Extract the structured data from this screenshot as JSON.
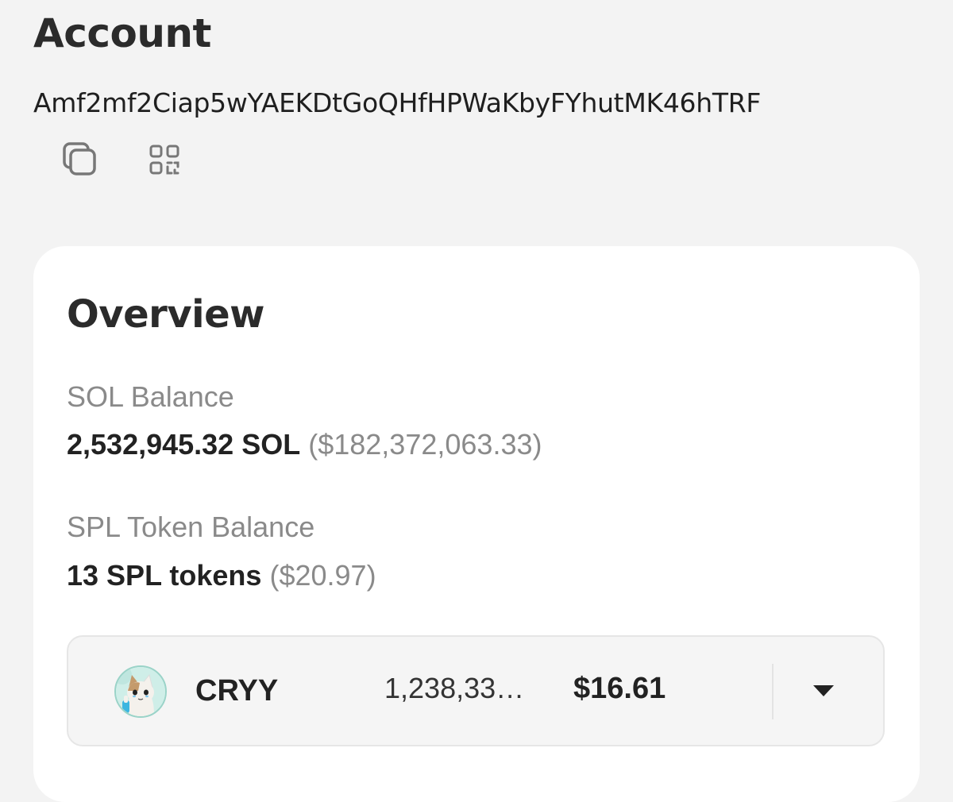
{
  "header": {
    "title": "Account",
    "address": "Amf2mf2Ciap5wYAEKDtGoQHfHPWaKbyFYhutMK46hTRF",
    "actions": [
      {
        "icon": "copy-icon"
      },
      {
        "icon": "qr-code-icon"
      }
    ]
  },
  "overview": {
    "title": "Overview",
    "sol": {
      "label": "SOL Balance",
      "amount": "2,532,945.32 SOL",
      "usd": "($182,372,063.33)"
    },
    "spl": {
      "label": "SPL Token Balance",
      "amount": "13 SPL tokens",
      "usd": "($20.97)"
    },
    "tokens": [
      {
        "icon": "cat-token-avatar",
        "symbol": "CRYY",
        "amount": "1,238,33…",
        "usd": "$16.61"
      }
    ]
  }
}
